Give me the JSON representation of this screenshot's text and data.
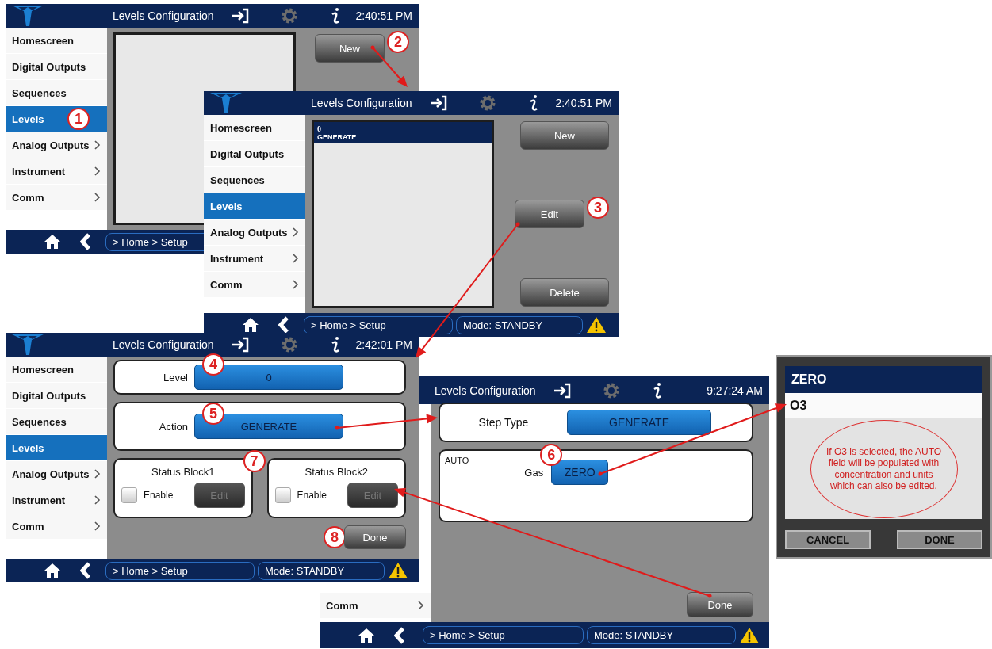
{
  "screens": [
    {
      "kind": "list",
      "title": "Levels Configuration",
      "time": "2:40:51 PM",
      "sidebar": [
        {
          "label": "Homescreen",
          "selected": false,
          "submenu": false
        },
        {
          "label": "Digital Outputs",
          "selected": false,
          "submenu": false
        },
        {
          "label": "Sequences",
          "selected": false,
          "submenu": false
        },
        {
          "label": "Levels",
          "selected": true,
          "submenu": false,
          "callout": "1"
        },
        {
          "label": "Analog Outputs",
          "selected": false,
          "submenu": true
        },
        {
          "label": "Instrument",
          "selected": false,
          "submenu": true
        },
        {
          "label": "Comm",
          "selected": false,
          "submenu": true
        }
      ],
      "buttons": [
        {
          "label": "New",
          "callout": "2"
        }
      ],
      "breadcrumb": "> Home > Setup"
    },
    {
      "kind": "list",
      "title": "Levels Configuration",
      "time": "2:40:51 PM",
      "sidebar": [
        {
          "label": "Homescreen",
          "selected": false,
          "submenu": false
        },
        {
          "label": "Digital Outputs",
          "selected": false,
          "submenu": false
        },
        {
          "label": "Sequences",
          "selected": false,
          "submenu": false
        },
        {
          "label": "Levels",
          "selected": true,
          "submenu": false
        },
        {
          "label": "Analog Outputs",
          "selected": false,
          "submenu": true
        },
        {
          "label": "Instrument",
          "selected": false,
          "submenu": true
        },
        {
          "label": "Comm",
          "selected": false,
          "submenu": true
        }
      ],
      "list_items": [
        {
          "value": "0",
          "name": "GENERATE",
          "selected": true
        }
      ],
      "buttons": [
        {
          "label": "New"
        },
        {
          "label": "Edit",
          "callout": "3"
        },
        {
          "label": "Delete"
        }
      ],
      "breadcrumb": "> Home > Setup",
      "mode": "Mode: STANDBY"
    },
    {
      "kind": "level_edit",
      "title": "Levels Configuration",
      "time": "2:42:01 PM",
      "sidebar": [
        {
          "label": "Homescreen",
          "selected": false,
          "submenu": false
        },
        {
          "label": "Digital Outputs",
          "selected": false,
          "submenu": false
        },
        {
          "label": "Sequences",
          "selected": false,
          "submenu": false
        },
        {
          "label": "Levels",
          "selected": true,
          "submenu": false
        },
        {
          "label": "Analog Outputs",
          "selected": false,
          "submenu": true
        },
        {
          "label": "Instrument",
          "selected": false,
          "submenu": true
        },
        {
          "label": "Comm",
          "selected": false,
          "submenu": true
        }
      ],
      "fields": [
        {
          "label": "Level",
          "value": "0",
          "callout": "4"
        },
        {
          "label": "Action",
          "value": "GENERATE",
          "callout": "5"
        }
      ],
      "status_blocks": [
        {
          "title": "Status Block1",
          "checkbox_label": "Enable",
          "checked": false,
          "button": "Edit",
          "disabled": true,
          "callout": "7"
        },
        {
          "title": "Status Block2",
          "checkbox_label": "Enable",
          "checked": false,
          "button": "Edit",
          "disabled": true
        }
      ],
      "done_button": {
        "label": "Done",
        "callout": "8"
      },
      "breadcrumb": "> Home > Setup",
      "mode": "Mode: STANDBY"
    },
    {
      "kind": "step_edit",
      "title": "Levels Configuration",
      "time": "9:27:24 AM",
      "sidebar": [
        {
          "label": "Comm",
          "selected": false,
          "submenu": true
        }
      ],
      "step_type": {
        "label": "Step Type",
        "value": "GENERATE"
      },
      "auto": {
        "label": "AUTO",
        "gas_label": "Gas",
        "gas_value": "ZERO",
        "callout": "6"
      },
      "done_button": {
        "label": "Done"
      },
      "breadcrumb": "> Home > Setup",
      "mode": "Mode: STANDBY"
    }
  ],
  "popup": {
    "title": "ZERO",
    "options": [
      {
        "label": "O3"
      }
    ],
    "note": "If O3 is selected, the AUTO field will be populated with concentration and units which can also be edited.",
    "buttons": [
      "CANCEL",
      "DONE"
    ]
  }
}
